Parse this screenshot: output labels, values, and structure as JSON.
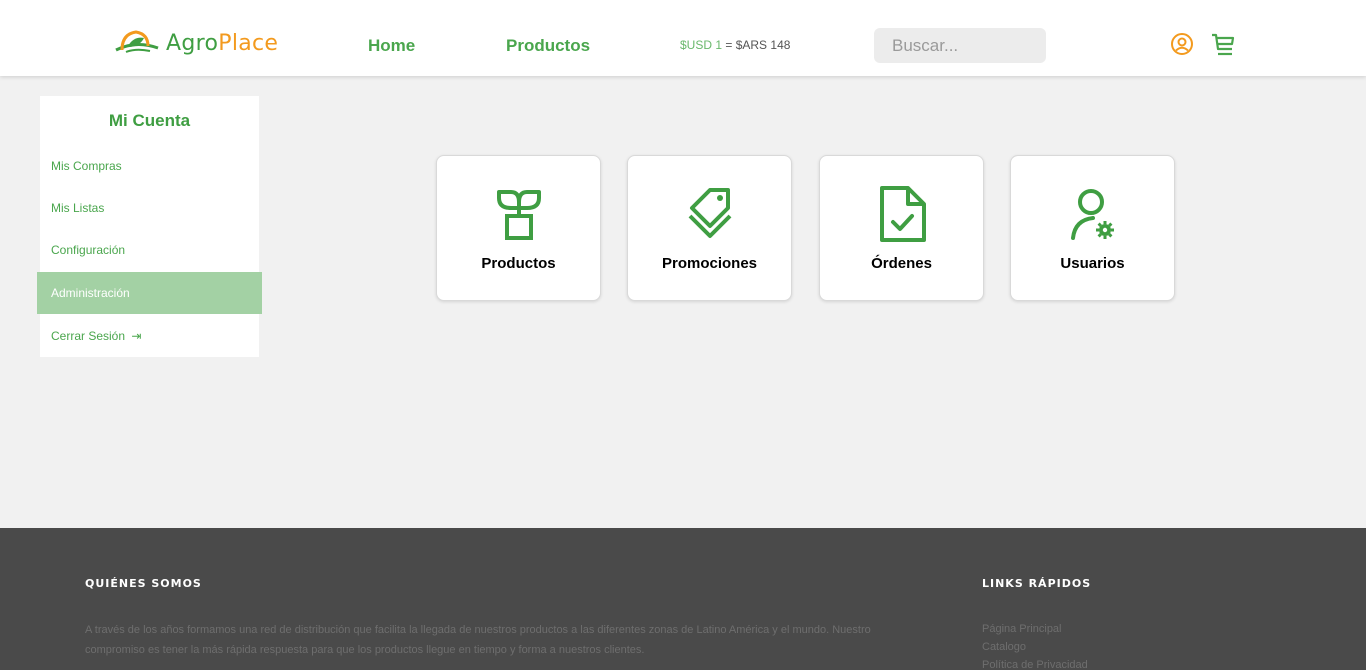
{
  "header": {
    "logo": {
      "part1": "Agro",
      "part2": "Place",
      "icon": "leaf-logo-icon"
    },
    "nav": {
      "home": "Home",
      "products": "Productos"
    },
    "currency": {
      "usd": "$USD 1",
      "rate": " = $ARS 148"
    },
    "search": {
      "placeholder": "Buscar..."
    },
    "icons": {
      "user": "user-circle-icon",
      "cart": "cart-icon"
    }
  },
  "sidebar": {
    "title": "Mi Cuenta",
    "items": [
      {
        "label": "Mis Compras"
      },
      {
        "label": "Mis Listas"
      },
      {
        "label": "Configuración"
      },
      {
        "label": "Administración",
        "active": true
      },
      {
        "label": "Cerrar Sesión",
        "icon": "logout-icon"
      }
    ]
  },
  "cards": [
    {
      "label": "Productos",
      "icon": "plant-icon"
    },
    {
      "label": "Promociones",
      "icon": "tag-icon"
    },
    {
      "label": "Órdenes",
      "icon": "document-check-icon"
    },
    {
      "label": "Usuarios",
      "icon": "user-gear-icon"
    }
  ],
  "footer": {
    "about": {
      "heading": "QUIÉNES SOMOS",
      "text": "A través de los años formamos una red de distribución que facilita la llegada de nuestros productos a las diferentes zonas de Latino América y el mundo. Nuestro compromiso es tener la más rápida respuesta para que los productos llegue en tiempo y forma a nuestros clientes."
    },
    "links": {
      "heading": "LINKS RÁPIDOS",
      "items": [
        "Página Principal",
        "Catalogo",
        "Política de Privacidad"
      ]
    }
  },
  "colors": {
    "primary_green": "#4aa64d",
    "logo_orange": "#f39a1e",
    "active_bg": "#a3d1a4",
    "footer_bg": "#4a4a4a"
  }
}
